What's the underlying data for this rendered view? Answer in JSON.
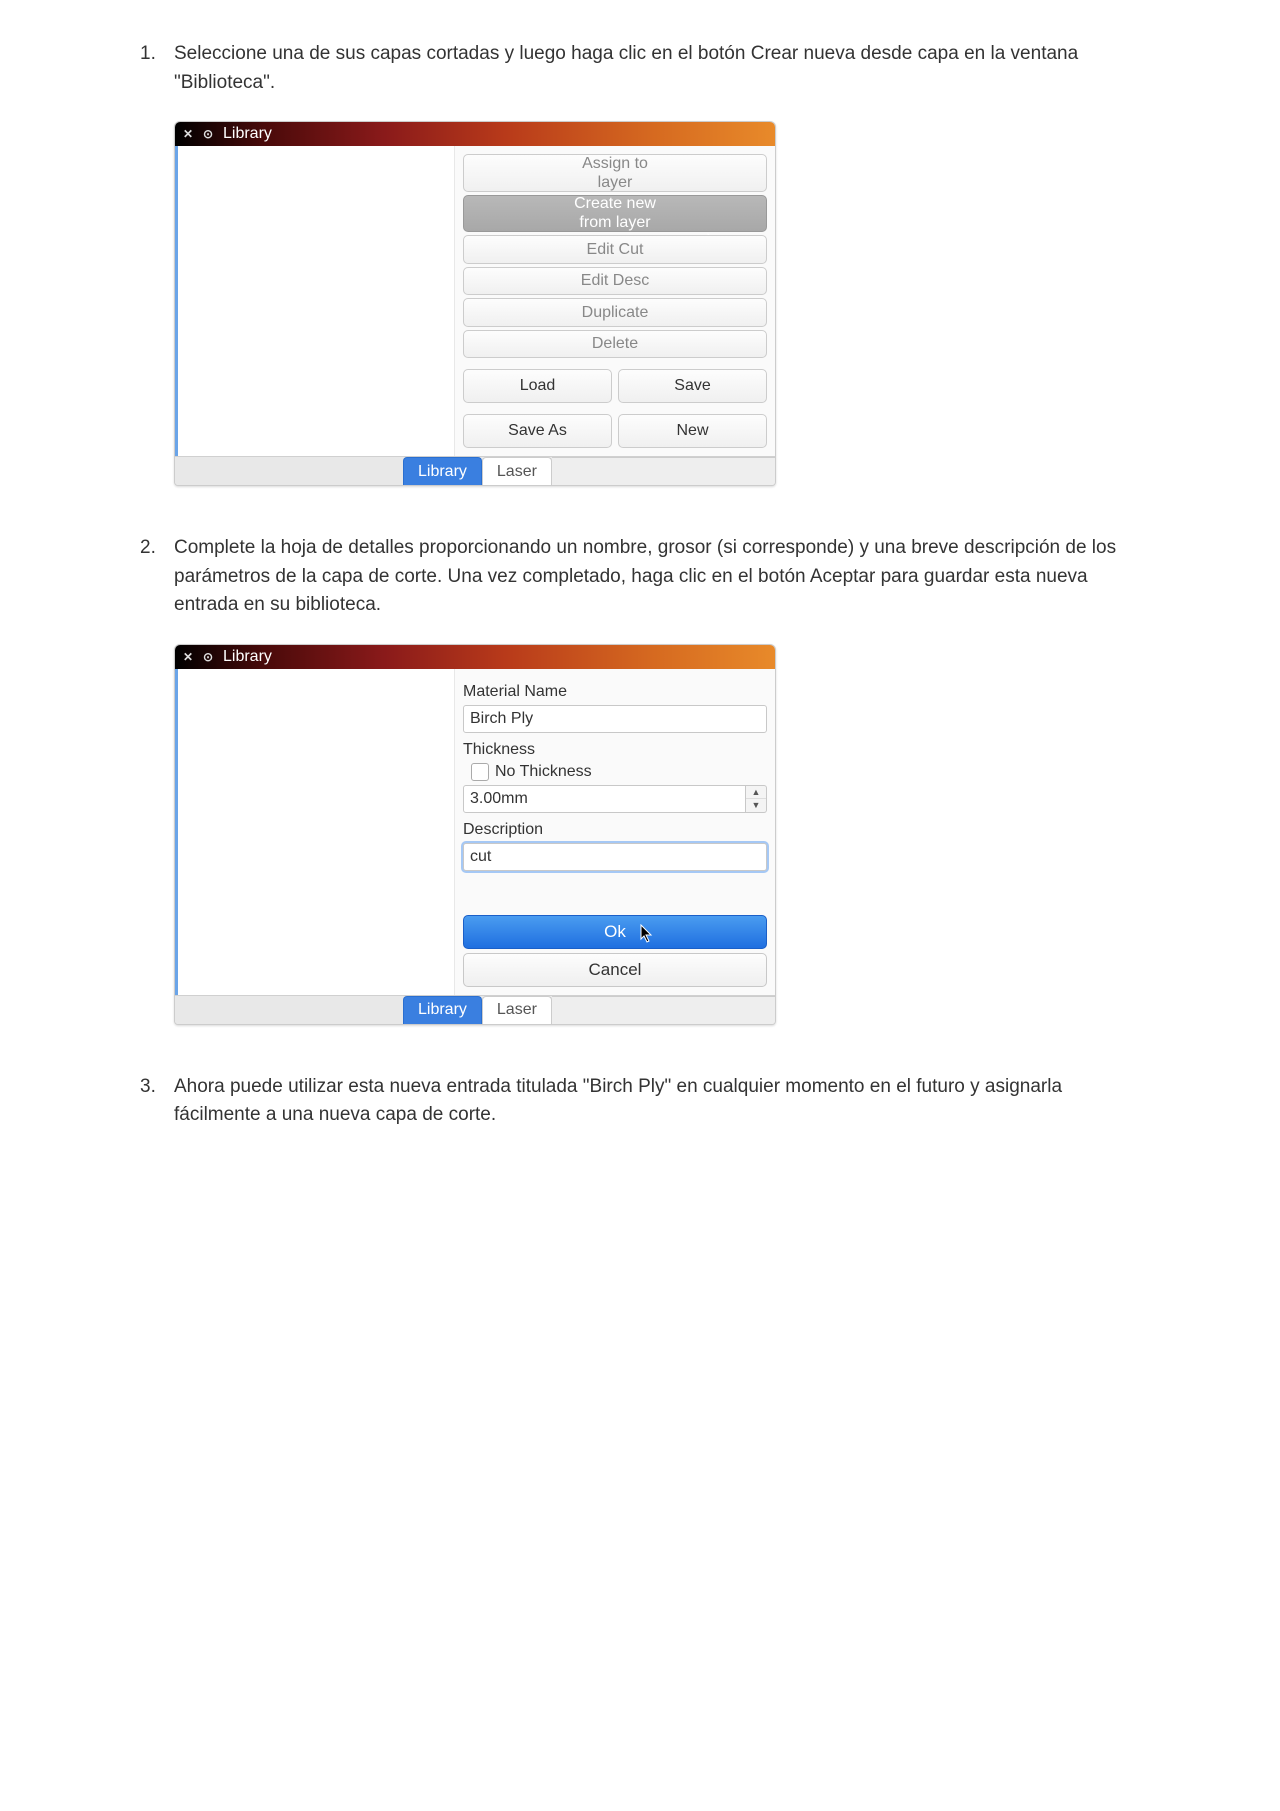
{
  "step1": {
    "num": "1.",
    "text": "Seleccione una de sus capas cortadas y luego haga clic en el botón Crear nueva desde capa en la ventana \"Biblioteca\"."
  },
  "step2": {
    "num": "2.",
    "text": "Complete la hoja de detalles proporcionando un nombre, grosor (si corresponde) y una breve descripción de los parámetros de la capa de corte. Una vez completado, haga clic en el botón Aceptar para guardar esta nueva entrada en su biblioteca."
  },
  "step3": {
    "num": "3.",
    "text": "Ahora puede utilizar esta nueva entrada titulada \"Birch Ply\" en cualquier momento en el futuro y asignarla fácilmente a una nueva capa de corte."
  },
  "win1": {
    "title": "Library",
    "buttons": {
      "assign": "Assign to\nlayer",
      "create": "Create new\nfrom layer",
      "editcut": "Edit Cut",
      "editdesc": "Edit Desc",
      "duplicate": "Duplicate",
      "delete": "Delete",
      "load": "Load",
      "save": "Save",
      "saveas": "Save As",
      "new": "New"
    },
    "tabs": {
      "library": "Library",
      "laser": "Laser"
    }
  },
  "win2": {
    "title": "Library",
    "labels": {
      "material": "Material Name",
      "thickness": "Thickness",
      "nothick": "No Thickness",
      "desc": "Description"
    },
    "values": {
      "material": "Birch Ply",
      "thickness": "3.00mm",
      "desc": "cut"
    },
    "buttons": {
      "ok": "Ok",
      "cancel": "Cancel"
    },
    "tabs": {
      "library": "Library",
      "laser": "Laser"
    }
  }
}
